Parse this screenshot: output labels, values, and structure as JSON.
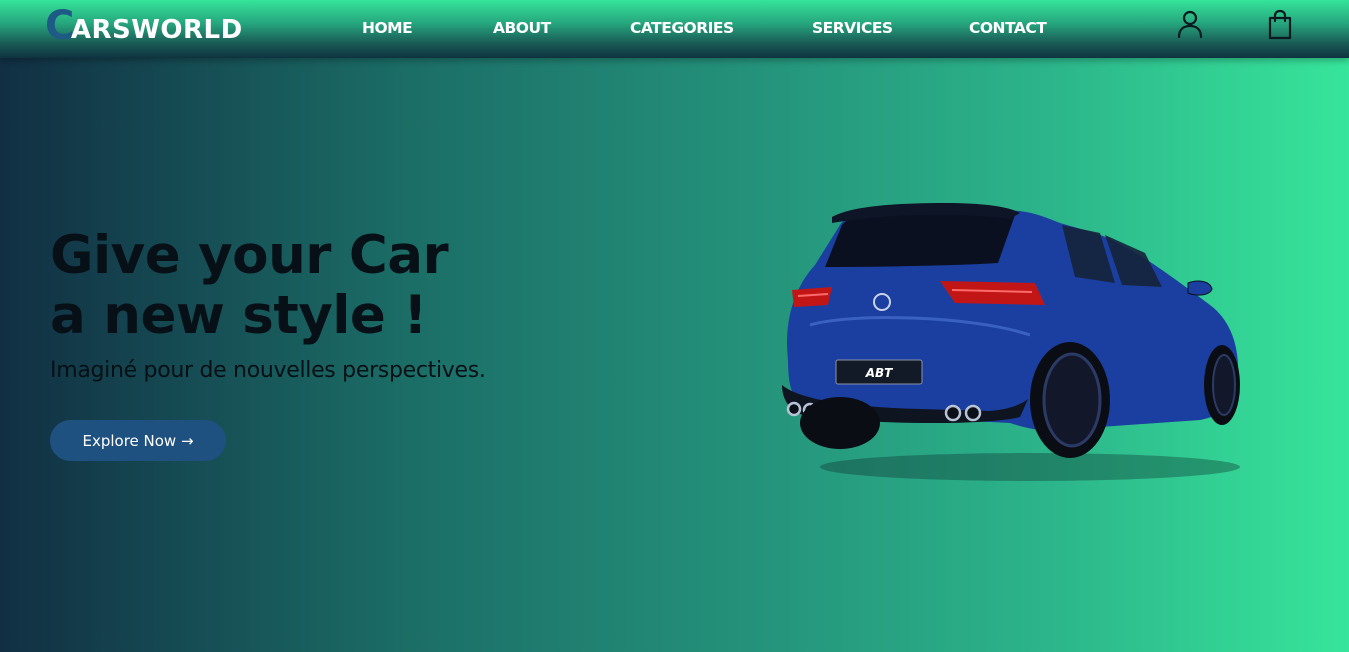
{
  "brand": {
    "initial": "C",
    "rest": "ARSWORLD"
  },
  "nav": {
    "links": [
      {
        "label": "HOME"
      },
      {
        "label": "ABOUT"
      },
      {
        "label": "CATEGORIES"
      },
      {
        "label": "SERVICES"
      },
      {
        "label": "CONTACT"
      }
    ],
    "icons": [
      "user-icon",
      "shopping-bag-icon"
    ]
  },
  "hero": {
    "title_line1": "Give your Car",
    "title_line2": "a new style !",
    "subtitle": "Imaginé pour de nouvelles perspectives.",
    "cta_label": "Explore Now →",
    "plate_text": "ABT"
  },
  "colors": {
    "gradient_start": "#112f43",
    "gradient_end": "#37e59b",
    "button_bg": "#1f5180",
    "logo_initial": "#1d5a86",
    "car_body": "#1b3fa0"
  }
}
